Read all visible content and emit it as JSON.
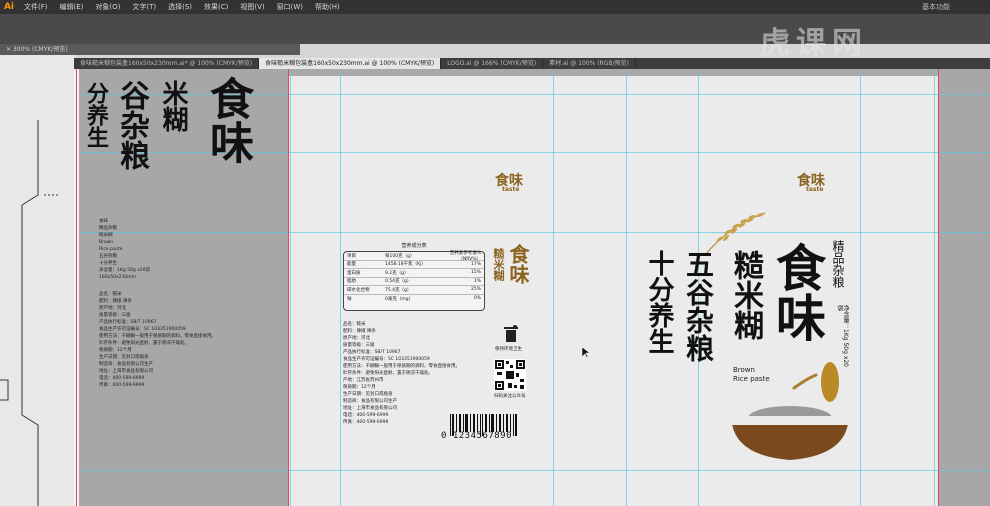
{
  "app": {
    "logo": "Ai",
    "workspace": "基本功能"
  },
  "menu": [
    "文件(F)",
    "编辑(E)",
    "对象(O)",
    "文字(T)",
    "选择(S)",
    "效果(C)",
    "视图(V)",
    "窗口(W)",
    "帮助(H)"
  ],
  "back_tab": "✕ 300% (CMYK/预览)",
  "tabs": [
    "食味糙米糊包装盒160x50x230mm.ai* @ 100% (CMYK/预览)",
    "食味糙米糊包装盒160x50x230mm.ai @ 100% (CMYK/预览)",
    "LOGO.ai @ 166% (CMYK/预览)",
    "素材.ai @ 100% (RGB/预览)"
  ],
  "left_big": {
    "col1": "分养生",
    "col2": "谷杂粮",
    "col3": "米糊",
    "col4": "食味"
  },
  "grey_info": [
    "食味",
    "精品杂粮",
    "糙米糊",
    "Brown",
    "Rice paste",
    "五谷杂粮",
    "十分养生",
    "净含量：1Kg 50g x20袋",
    "160x50x230mm",
    "品名：糙米",
    "配料：辣椒 辣条",
    "原产地：河北",
    "质量等级：三级",
    "产品执行标准：SB/T 10967",
    "食品生产许可证编号：SC 103351900059",
    "使用方法：干糊糊一般用于保质期的调料，零食直接食用。",
    "贮存条件：避免阳光直射，置于阴凉干燥处。",
    "保质期：12个月",
    "生产日期：见封口或瓶身",
    "制造商：食品有限公司生产",
    "地址：上海市食品有限公司",
    "电话：400-599-6999",
    "传真：400-599-6999"
  ],
  "nutrition": {
    "title": "营养成分表",
    "header": [
      "项目",
      "每100克（g）",
      "营养素参考值%（NRV%）"
    ],
    "rows": [
      [
        "能量",
        "1458.18千焦（Kj）",
        "17%"
      ],
      [
        "蛋白质",
        "9.2克（g）",
        "15%"
      ],
      [
        "脂肪",
        "0.54克（g）",
        "1%"
      ],
      [
        "碳水化合物",
        "75.4克（g）",
        "25%"
      ],
      [
        "钠",
        "0毫克（mg）",
        "0%"
      ]
    ]
  },
  "side_logo": {
    "text": "食味",
    "sub": "taste"
  },
  "side_name": {
    "a": "糙米糊",
    "b": "食味"
  },
  "info_lines": [
    "品名：糙米",
    "配料：辣椒 辣条",
    "原产地：河北",
    "质量等级：三级",
    "产品执行标准：SB/T 10967",
    "食品生产许可证编号：SC 103351900059",
    "使用方法：干糊糊一般用于保质期的调料，零食直接食用。",
    "贮存条件：避免阳光直射，置于阴凉干燥处。",
    "产地：江苏省苏州市",
    "保质期：12个月",
    "生产日期：见封口或瓶身",
    "制造商：食品有限公司生产",
    "地址：上海市食品有限公司",
    "电话：400-599-6999",
    "传真：400-599-6999"
  ],
  "recycle_label": "保持环境卫生",
  "qr_label": "扫码关注公众号",
  "barcode": "0 1234567890",
  "front": {
    "logo": "食味",
    "logo_sub": "taste",
    "col_a": "十分养生",
    "col_b": "五谷杂粮",
    "col_c": "糙米糊",
    "col_d": "食味",
    "side_vertical": "精品杂粮",
    "net": "净含量：1Kg 50g x20袋",
    "en1": "Brown",
    "en2": "Rice paste"
  },
  "watermark": "虎课网",
  "colors": {
    "brand": "#8b6420",
    "guide": "#5ec8e6",
    "redline": "#e0455a"
  }
}
